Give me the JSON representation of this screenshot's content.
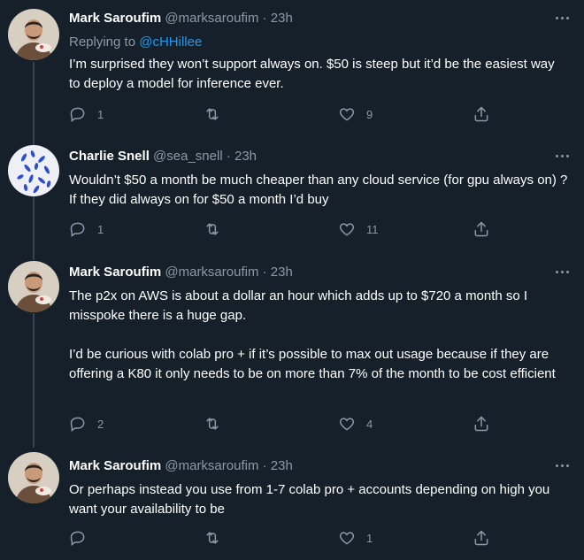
{
  "tweets": [
    {
      "name": "Mark Saroufim",
      "handle": "@marksaroufim",
      "dot": "·",
      "time": "23h",
      "reply_prefix": "Replying to ",
      "reply_handle": "@cHHillee",
      "text": "I’m surprised they won’t support always on. $50 is steep but it’d be the easiest way to deploy a model for inference ever.",
      "replies": "1",
      "retweets": "",
      "likes": "9"
    },
    {
      "name": "Charlie Snell",
      "handle": "@sea_snell",
      "dot": "·",
      "time": "23h",
      "text": "Wouldn’t $50 a month be much cheaper than any cloud service (for gpu always on) ? If they did always on for $50 a month I’d buy",
      "replies": "1",
      "retweets": "",
      "likes": "11"
    },
    {
      "name": "Mark Saroufim",
      "handle": "@marksaroufim",
      "dot": "·",
      "time": "23h",
      "text": "The p2x on AWS is about a dollar an hour which adds up to $720 a month so I misspoke there is a huge gap.\n\nI’d be curious with colab pro + if it’s possible to max out usage because if they are offering a K80 it only needs to be on more than 7% of the month to be cost efficient",
      "replies": "2",
      "retweets": "",
      "likes": "4"
    },
    {
      "name": "Mark Saroufim",
      "handle": "@marksaroufim",
      "dot": "·",
      "time": "23h",
      "text": "Or perhaps instead you use from 1-7 colab pro + accounts depending on high you want your availability to be",
      "replies": "",
      "retweets": "",
      "likes": "1"
    }
  ]
}
